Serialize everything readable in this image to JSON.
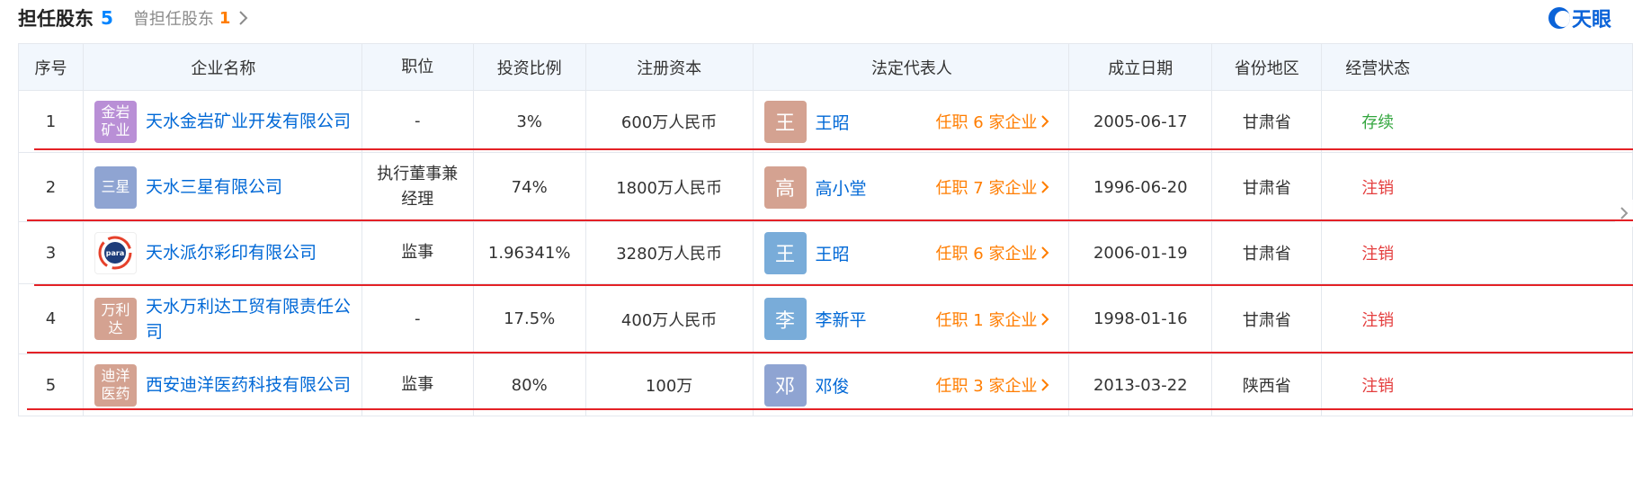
{
  "header": {
    "title": "担任股东",
    "title_count": "5",
    "former_label": "曾担任股东",
    "former_count": "1"
  },
  "logo": {
    "text": "天眼"
  },
  "columns": [
    "序号",
    "企业名称",
    "职位",
    "投资比例",
    "注册资本",
    "法定代表人",
    "成立日期",
    "省份地区",
    "经营状态"
  ],
  "rows": [
    {
      "idx": "1",
      "badge": "金岩矿业",
      "badge_color": "#b98fd6",
      "company": "天水金岩矿业开发有限公司",
      "position": "-",
      "ratio": "3%",
      "capital": "600万人民币",
      "rep_avatar": "王",
      "rep_color": "#d4a291",
      "rep_name": "王昭",
      "rep_jobs": "任职 6 家企业",
      "date": "2005-06-17",
      "province": "甘肃省",
      "status": "存续",
      "status_color": "#33a63e"
    },
    {
      "idx": "2",
      "badge": "三星",
      "badge_color": "#8fa4d2",
      "company": "天水三星有限公司",
      "position": "执行董事兼经理",
      "ratio": "74%",
      "capital": "1800万人民币",
      "rep_avatar": "高",
      "rep_color": "#d4a291",
      "rep_name": "高小堂",
      "rep_jobs": "任职 7 家企业",
      "date": "1996-06-20",
      "province": "甘肃省",
      "status": "注销",
      "status_color": "#e43e3e"
    },
    {
      "idx": "3",
      "badge": "para",
      "badge_color": "#ffffff",
      "company": "天水派尔彩印有限公司",
      "position": "监事",
      "ratio": "1.96341%",
      "capital": "3280万人民币",
      "rep_avatar": "王",
      "rep_color": "#79acd9",
      "rep_name": "王昭",
      "rep_jobs": "任职 6 家企业",
      "date": "2006-01-19",
      "province": "甘肃省",
      "status": "注销",
      "status_color": "#e43e3e"
    },
    {
      "idx": "4",
      "badge": "万利达",
      "badge_color": "#d4a291",
      "company": "天水万利达工贸有限责任公司",
      "position": "-",
      "ratio": "17.5%",
      "capital": "400万人民币",
      "rep_avatar": "李",
      "rep_color": "#79acd9",
      "rep_name": "李新平",
      "rep_jobs": "任职 1 家企业",
      "date": "1998-01-16",
      "province": "甘肃省",
      "status": "注销",
      "status_color": "#e43e3e"
    },
    {
      "idx": "5",
      "badge": "迪洋医药",
      "badge_color": "#d4a291",
      "company": "西安迪洋医药科技有限公司",
      "position": "监事",
      "ratio": "80%",
      "capital": "100万",
      "rep_avatar": "邓",
      "rep_color": "#8fa4d2",
      "rep_name": "邓俊",
      "rep_jobs": "任职 3 家企业",
      "date": "2013-03-22",
      "province": "陕西省",
      "status": "注销",
      "status_color": "#e43e3e"
    }
  ]
}
